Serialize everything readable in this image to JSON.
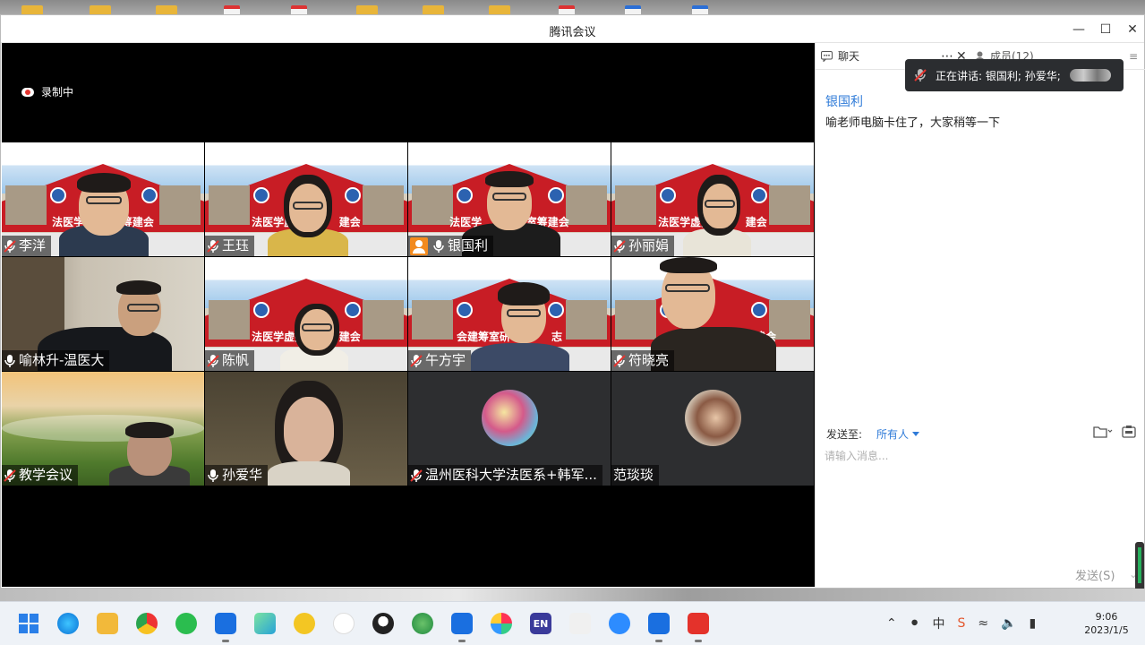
{
  "window": {
    "title": "腾讯会议"
  },
  "recording": {
    "label": "录制中"
  },
  "participants": [
    {
      "name": "李洋",
      "mic": "muted"
    },
    {
      "name": "王珏",
      "mic": "muted"
    },
    {
      "name": "银国利",
      "mic": "on",
      "host": true,
      "speaking": true
    },
    {
      "name": "孙丽娟",
      "mic": "muted"
    },
    {
      "name": "喻林升-温医大",
      "mic": "on"
    },
    {
      "name": "陈帆",
      "mic": "muted"
    },
    {
      "name": "午方宇",
      "mic": "muted"
    },
    {
      "name": "符晓亮",
      "mic": "muted"
    },
    {
      "name": "教学会议",
      "mic": "muted"
    },
    {
      "name": "孙爱华",
      "mic": "on"
    },
    {
      "name": "温州医科大学法医系+韩军...",
      "mic": "muted"
    },
    {
      "name": "范琰琰",
      "mic": "none"
    }
  ],
  "banner": {
    "text_1": "法医学",
    "text_1_end": "筹建会",
    "text_2": "法医学虚拟",
    "text_2_end": "建会",
    "text_3": "法医学",
    "text_3_end": "研室筹建会",
    "text_4": "法医学虚拟",
    "text_4_end": "建会",
    "text_6": "法医学虚拟",
    "text_6_end": "建会",
    "text_7": "会建筹室研",
    "text_7_end": "志",
    "text_8_end": "建会"
  },
  "chat_panel": {
    "tab_chat": "聊天",
    "tab_members": "成员(12)",
    "toast": "正在讲话: 银国利; 孙爱华;",
    "messages": [
      {
        "sender": "银国利",
        "text": "喻老师电脑卡住了，大家稍等一下"
      }
    ],
    "send_to_label": "发送至:",
    "send_to_value": "所有人",
    "input_placeholder": "请输入消息...",
    "send_label": "发送(S)"
  },
  "taskbar": {
    "time": "9:06",
    "date": "2023/1/5",
    "ime": "中",
    "en_label": "EN"
  },
  "colors": {
    "accent": "#2f7bd8",
    "speaking_outline": "#27b05c",
    "host_badge": "#f28a1e",
    "banner_red": "#c81d25"
  }
}
